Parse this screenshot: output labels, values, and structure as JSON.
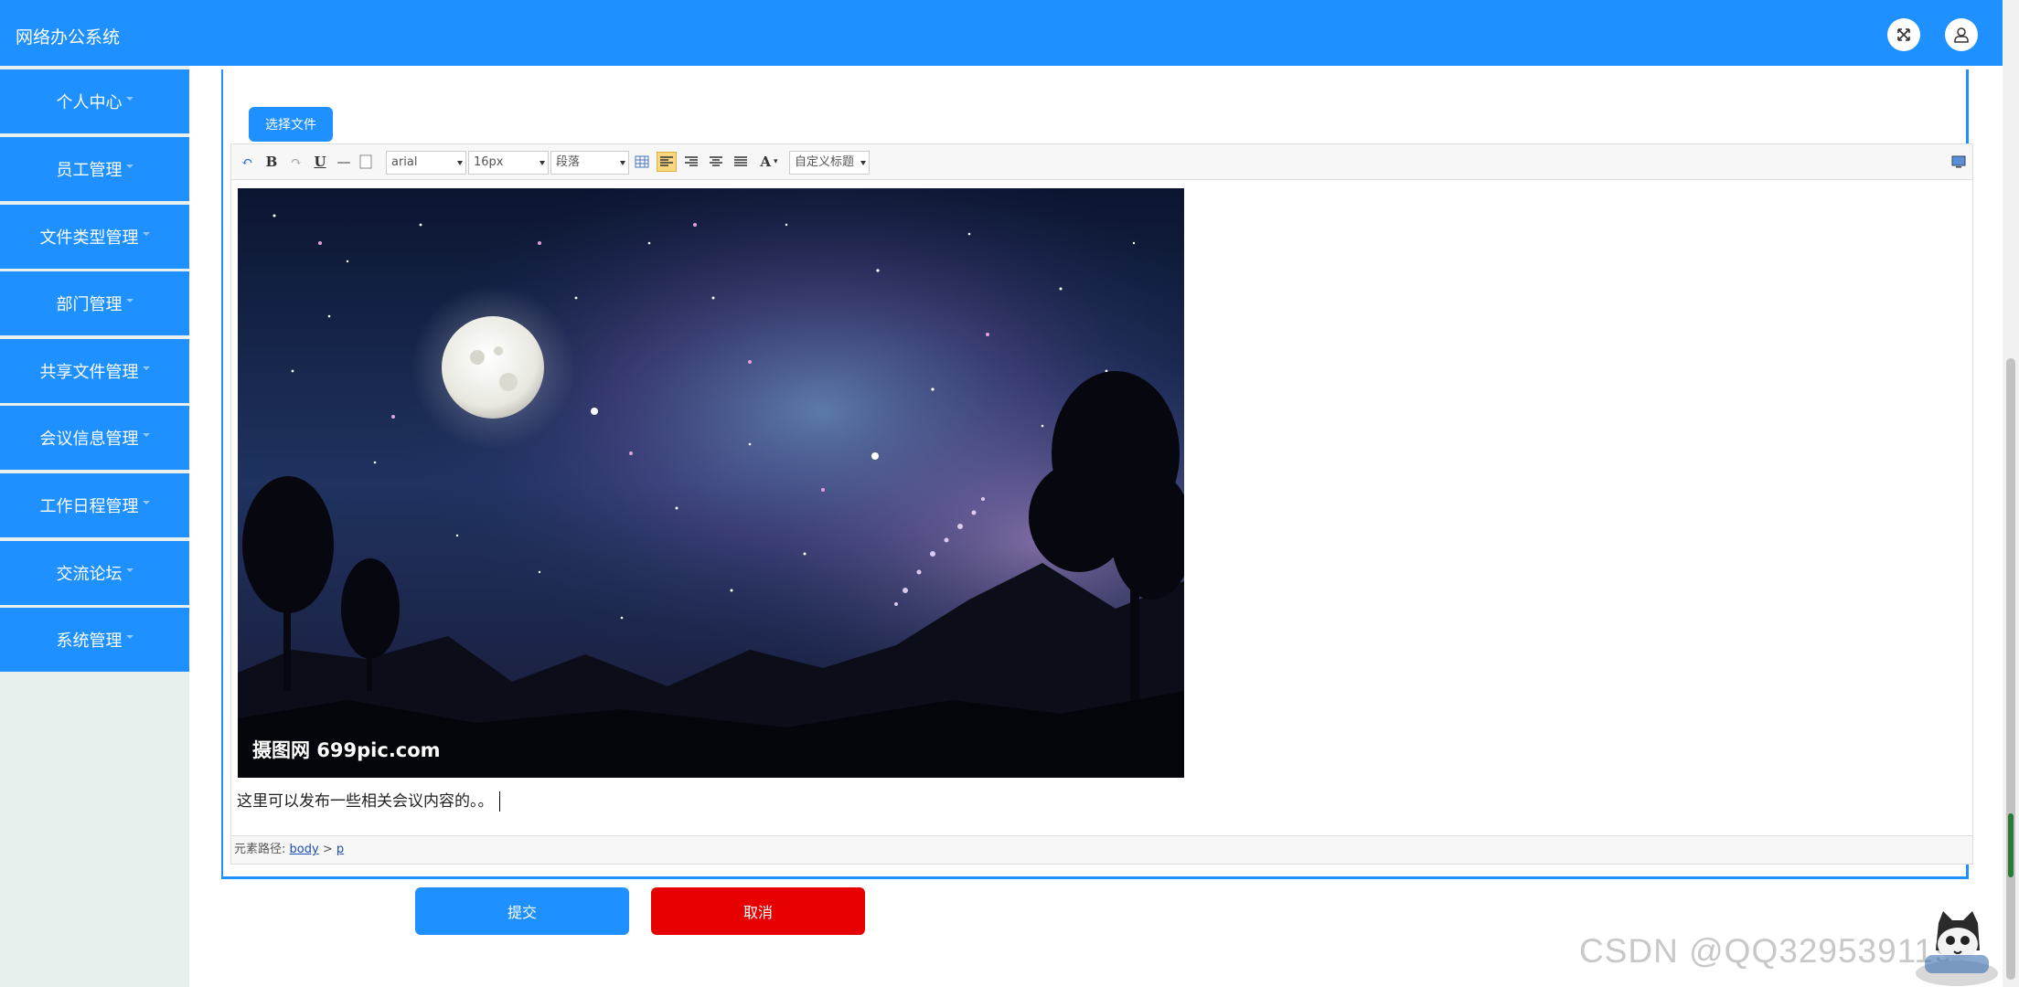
{
  "header": {
    "app_title": "网络办公系统",
    "fullscreen_icon": "expand-icon",
    "user_icon": "user-icon"
  },
  "sidebar": {
    "items": [
      {
        "label": "个人中心"
      },
      {
        "label": "员工管理"
      },
      {
        "label": "文件类型管理"
      },
      {
        "label": "部门管理"
      },
      {
        "label": "共享文件管理"
      },
      {
        "label": "会议信息管理"
      },
      {
        "label": "工作日程管理"
      },
      {
        "label": "交流论坛"
      },
      {
        "label": "系统管理"
      }
    ]
  },
  "editor": {
    "choose_file_label": "选择文件",
    "toolbar": {
      "undo_icon": "undo-icon",
      "bold": "B",
      "redo_icon": "redo-icon",
      "underline": "U",
      "hr_icon": "horizontal-rule-icon",
      "paste_icon": "paste-icon",
      "font_family": "arial",
      "font_size": "16px",
      "paragraph": "段落",
      "table_icon": "table-icon",
      "font_color": "A",
      "custom_title": "自定义标题",
      "fullscreen_icon": "fullscreen-icon"
    },
    "image_watermark": "摄图网 699pic.com",
    "body_text": "这里可以发布一些相关会议内容的。。",
    "path_label": "元素路径:",
    "path_body": "body",
    "path_sep": ">",
    "path_p": "p"
  },
  "actions": {
    "submit_label": "提交",
    "cancel_label": "取消"
  },
  "watermark": "CSDN @QQ3295391197",
  "colors": {
    "primary": "#1e90ff",
    "danger": "#e60000",
    "sidebar_bg": "#e8f0ee"
  }
}
